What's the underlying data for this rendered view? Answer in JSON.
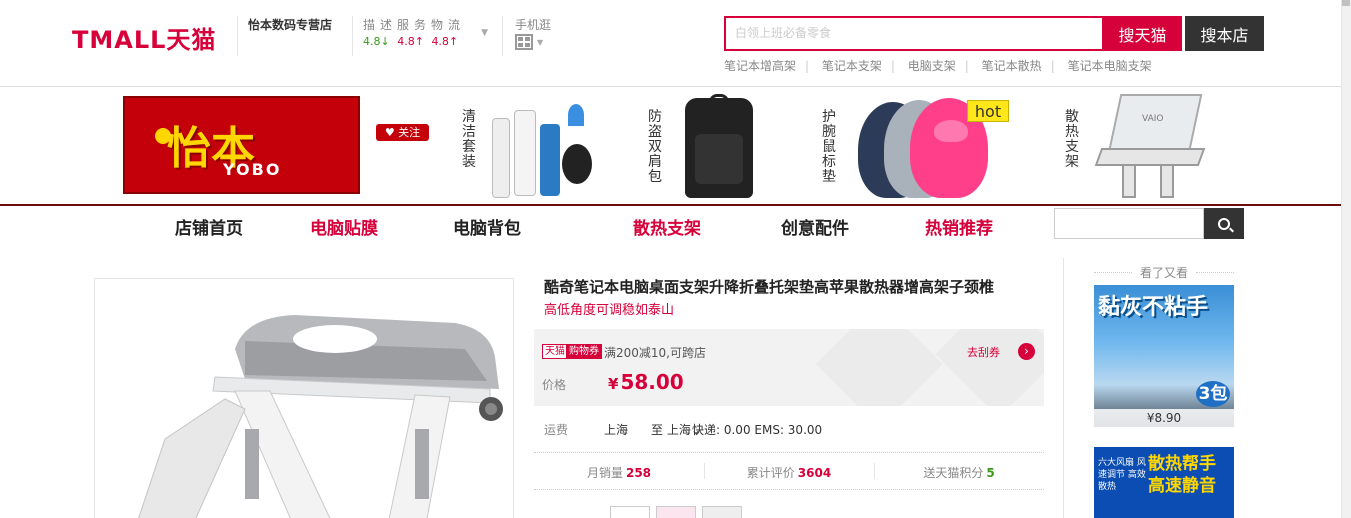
{
  "header": {
    "logo": "TMALL天猫",
    "shop_name": "怡本数码专营店",
    "ratings_label": "描述服务物流",
    "ratings": [
      "4.8↓",
      "4.8↑",
      "4.8↑"
    ],
    "mobile_label": "手机逛"
  },
  "search": {
    "placeholder": "白领上班必备零食",
    "btn_tmall": "搜天猫",
    "btn_shop": "搜本店",
    "hot_words": [
      "笔记本增高架",
      "笔记本支架",
      "电脑支架",
      "笔记本散热",
      "笔记本电脑支架"
    ]
  },
  "banner": {
    "brand_cn": "怡本",
    "brand_en": "YOBO",
    "follow": "♥ 关注",
    "categories": [
      {
        "label": "清洁套装"
      },
      {
        "label": "防盗双肩包"
      },
      {
        "label": "护腕鼠标垫"
      },
      {
        "label": "散热支架"
      }
    ],
    "hot": "hot",
    "laptop_brand": "VAIO"
  },
  "nav": {
    "items": [
      {
        "label": "店铺首页"
      },
      {
        "label": "电脑贴膜"
      },
      {
        "label": "电脑背包"
      },
      {
        "label": "散热支架"
      },
      {
        "label": "创意配件"
      },
      {
        "label": "热销推荐"
      }
    ]
  },
  "product": {
    "title": "酷奇笔记本电脑桌面支架升降折叠托架垫高苹果散热器增高架子颈椎",
    "subtitle": "高低角度可调稳如泰山",
    "tag_tmall": "天猫",
    "tag_coupon": "购物券",
    "coupon_text": "满200减10,可跨店",
    "get_coupon": "去刮券",
    "price_label": "价格",
    "currency": "¥",
    "price": "58.00",
    "ship_label": "运费",
    "ship_from": "上海",
    "ship_to": "至 上海",
    "ship_fee": "快递: 0.00 EMS: 30.00",
    "stats": [
      {
        "label": "月销量",
        "value": "258"
      },
      {
        "label": "累计评价",
        "value": "3604"
      },
      {
        "label": "送天猫积分",
        "value": "5"
      }
    ]
  },
  "sidebar": {
    "title": "看了又看",
    "items": [
      {
        "headline": "黏灰不粘手",
        "badge": "3包",
        "price": "¥8.90"
      },
      {
        "small": "六大风扇 风速调节 高效散热",
        "headline": "散热帮手 高速静音"
      }
    ]
  },
  "colors": {
    "accent": "#d6003a",
    "dark": "#333333",
    "nav_border": "#6b0d0d"
  }
}
